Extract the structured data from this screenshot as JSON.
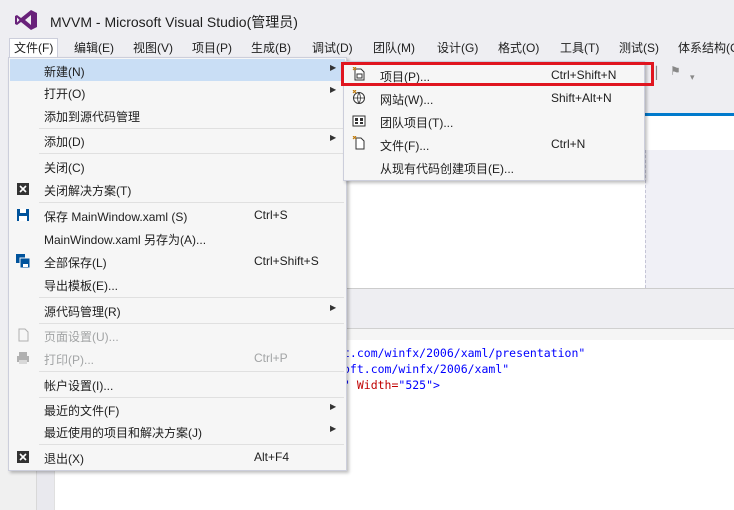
{
  "window": {
    "title": "MVVM - Microsoft Visual Studio(管理员)"
  },
  "menubar": {
    "items": [
      "文件(F)",
      "编辑(E)",
      "视图(V)",
      "项目(P)",
      "生成(B)",
      "调试(D)",
      "团队(M)",
      "设计(G)",
      "格式(O)",
      "工具(T)",
      "测试(S)",
      "体系结构(C"
    ]
  },
  "file_menu": {
    "items": [
      {
        "label": "新建(N)",
        "shortcut": "",
        "submenu": true
      },
      {
        "label": "打开(O)",
        "shortcut": "",
        "submenu": true
      },
      {
        "label": "添加到源代码管理",
        "shortcut": ""
      },
      {
        "label": "添加(D)",
        "shortcut": "",
        "submenu": true
      },
      {
        "label": "关闭(C)",
        "shortcut": ""
      },
      {
        "label": "关闭解决方案(T)",
        "shortcut": "",
        "icon": "close-solution-icon"
      },
      {
        "label": "保存 MainWindow.xaml (S)",
        "shortcut": "Ctrl+S",
        "icon": "save-icon"
      },
      {
        "label": "MainWindow.xaml 另存为(A)...",
        "shortcut": ""
      },
      {
        "label": "全部保存(L)",
        "shortcut": "Ctrl+Shift+S",
        "icon": "save-all-icon"
      },
      {
        "label": "导出模板(E)...",
        "shortcut": ""
      },
      {
        "label": "源代码管理(R)",
        "shortcut": "",
        "submenu": true
      },
      {
        "label": "页面设置(U)...",
        "shortcut": "",
        "disabled": true,
        "icon": "page-setup-icon"
      },
      {
        "label": "打印(P)...",
        "shortcut": "Ctrl+P",
        "disabled": true,
        "icon": "print-icon"
      },
      {
        "label": "帐户设置(I)...",
        "shortcut": ""
      },
      {
        "label": "最近的文件(F)",
        "shortcut": "",
        "submenu": true
      },
      {
        "label": "最近使用的项目和解决方案(J)",
        "shortcut": "",
        "submenu": true
      },
      {
        "label": "退出(X)",
        "shortcut": "Alt+F4",
        "icon": "exit-icon"
      }
    ]
  },
  "new_submenu": {
    "items": [
      {
        "label": "项目(P)...",
        "shortcut": "Ctrl+Shift+N",
        "icon": "new-project-icon"
      },
      {
        "label": "网站(W)...",
        "shortcut": "Shift+Alt+N",
        "icon": "website-icon"
      },
      {
        "label": "团队项目(T)...",
        "shortcut": "",
        "icon": "team-project-icon"
      },
      {
        "label": "文件(F)...",
        "shortcut": "Ctrl+N",
        "icon": "new-file-icon"
      },
      {
        "label": "从现有代码创建项目(E)...",
        "shortcut": ""
      }
    ]
  },
  "code": {
    "line1": "t.com/winfx/2006/xaml/presentation\"",
    "line2": "oft.com/winfx/2006/xaml\"",
    "line3_a": "\" ",
    "line3_attr": "Width=",
    "line3_val": "\"525\"",
    "line3_end": ">"
  },
  "colors": {
    "accent": "#007acc",
    "highlight": "#c9def5",
    "annotation": "#e0151f",
    "vs_purple": "#68217a"
  }
}
